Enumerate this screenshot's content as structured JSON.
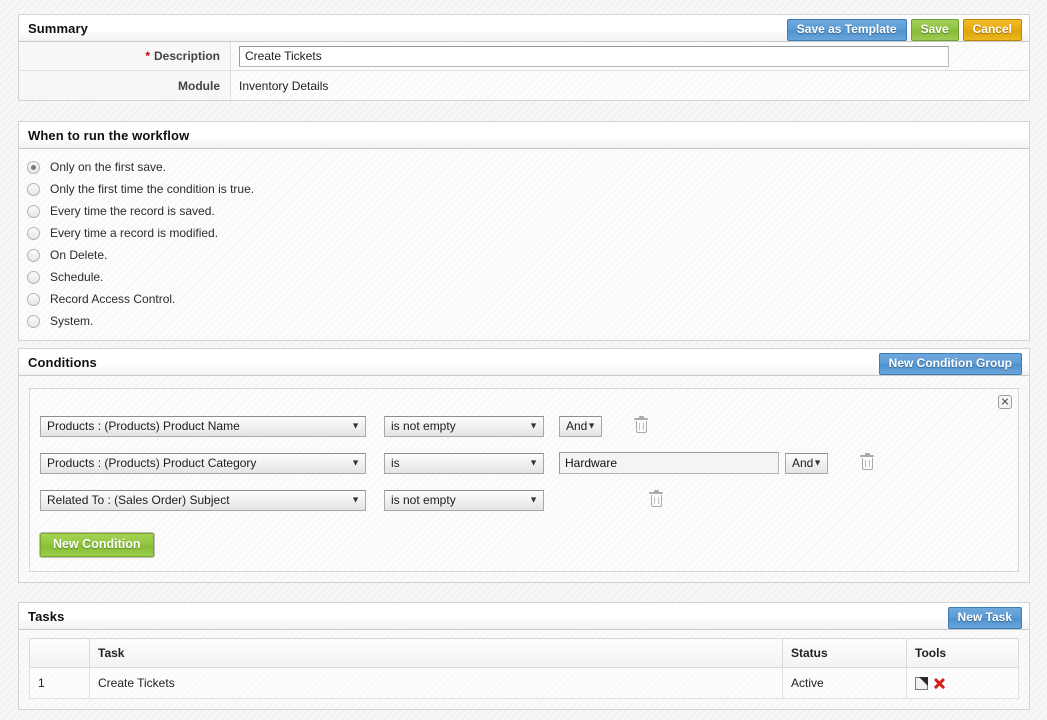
{
  "summary": {
    "title": "Summary",
    "buttons": {
      "save_as_template": "Save as Template",
      "save": "Save",
      "cancel": "Cancel"
    },
    "rows": [
      {
        "label": "Description",
        "required": true,
        "value": "Create Tickets",
        "type": "input"
      },
      {
        "label": "Module",
        "required": false,
        "value": "Inventory Details",
        "type": "text"
      }
    ]
  },
  "when_to_run": {
    "title": "When to run the workflow",
    "selected_index": 0,
    "options": [
      "Only on the first save.",
      "Only the first time the condition is true.",
      "Every time the record is saved.",
      "Every time a record is modified.",
      "On Delete.",
      "Schedule.",
      "Record Access Control.",
      "System."
    ]
  },
  "conditions": {
    "title": "Conditions",
    "new_condition_group_label": "New Condition Group",
    "new_condition_label": "New Condition",
    "group": {
      "rows": [
        {
          "field": "Products : (Products) Product Name",
          "operator": "is not empty",
          "value": null,
          "has_value_input": false,
          "join": "And",
          "has_join": true
        },
        {
          "field": "Products : (Products) Product Category",
          "operator": "is",
          "value": "Hardware",
          "has_value_input": true,
          "join": "And",
          "has_join": true
        },
        {
          "field": "Related To : (Sales Order) Subject",
          "operator": "is not empty",
          "value": null,
          "has_value_input": false,
          "join": null,
          "has_join": false
        }
      ]
    }
  },
  "tasks": {
    "title": "Tasks",
    "new_task_label": "New Task",
    "columns": [
      "",
      "Task",
      "Status",
      "Tools"
    ],
    "rows": [
      {
        "num": "1",
        "task": "Create Tickets",
        "status": "Active"
      }
    ]
  },
  "colors": {
    "blue": "#5b9bd5",
    "green": "#8dc23f",
    "orange": "#e7a90d",
    "required_star": "#cc0000",
    "delete_icon": "#d61f1f"
  }
}
